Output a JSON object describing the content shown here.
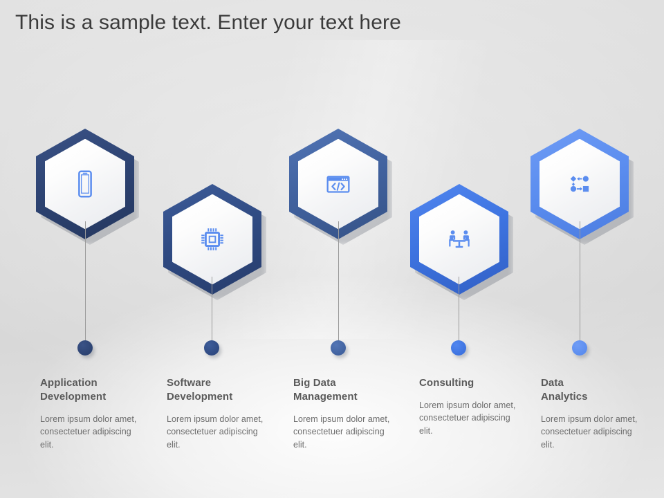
{
  "slide": {
    "title": "This is a sample text. Enter your text here",
    "background_color": "#dedede",
    "title_color": "#3b3b3b"
  },
  "steps": [
    {
      "id": "application-development",
      "title": "Application\nDevelopment",
      "body": "Lorem ipsum dolor amet, consectetuer adipiscing elit.",
      "icon": "smartphone-icon",
      "ring_color": "#2d4372",
      "ring_color_light": "#3a5286",
      "dot_color": "#2d4372",
      "icon_color": "#5b8def"
    },
    {
      "id": "software-development",
      "title": "Software\nDevelopment",
      "body": "Lorem ipsum dolor amet, consectetuer adipiscing elit.",
      "icon": "cpu-chip-icon",
      "ring_color": "#2f4a82",
      "ring_color_light": "#3d5c99",
      "dot_color": "#2f4a82",
      "icon_color": "#5b8def"
    },
    {
      "id": "big-data-management",
      "title": "Big Data\nManagement",
      "body": "Lorem ipsum dolor amet, consectetuer adipiscing elit.",
      "icon": "code-window-icon",
      "ring_color": "#41629f",
      "ring_color_light": "#5275b5",
      "dot_color": "#41629f",
      "icon_color": "#5b8def"
    },
    {
      "id": "consulting",
      "title": "Consulting",
      "body": "Lorem ipsum dolor amet, consectetuer adipiscing elit.",
      "icon": "meeting-table-icon",
      "ring_color": "#3d73e0",
      "ring_color_light": "#5186ef",
      "dot_color": "#3d73e0",
      "icon_color": "#5b8def"
    },
    {
      "id": "data-analytics",
      "title": "Data\nAnalytics",
      "body": "Lorem ipsum dolor amet, consectetuer adipiscing elit.",
      "icon": "data-flow-diagram-icon",
      "ring_color": "#5b8def",
      "ring_color_light": "#6f9cf5",
      "dot_color": "#5b8def",
      "icon_color": "#5b8def"
    }
  ]
}
